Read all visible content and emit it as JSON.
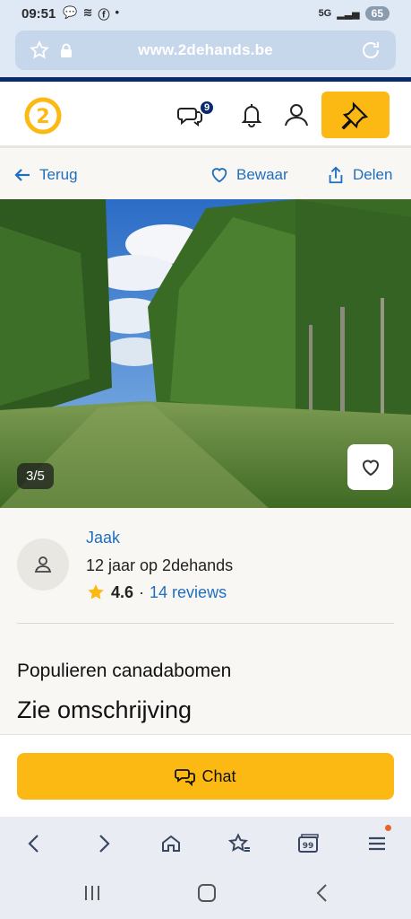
{
  "status_bar": {
    "time": "09:51",
    "network": "5G",
    "battery": "65"
  },
  "browser": {
    "url": "www.2dehands.be"
  },
  "header": {
    "message_count": "9"
  },
  "actions": {
    "back_label": "Terug",
    "save_label": "Bewaar",
    "share_label": "Delen"
  },
  "photo": {
    "counter": "3/5"
  },
  "seller": {
    "name": "Jaak",
    "since": "12 jaar op 2dehands",
    "rating": "4.6",
    "separator": "·",
    "reviews": "14 reviews"
  },
  "listing": {
    "title": "Populieren canadabomen",
    "description_link": "Zie omschrijving"
  },
  "chat": {
    "label": "Chat"
  },
  "colors": {
    "accent": "#fdb913",
    "link": "#1f6fbf",
    "brand_dark": "#0b2a6b"
  }
}
